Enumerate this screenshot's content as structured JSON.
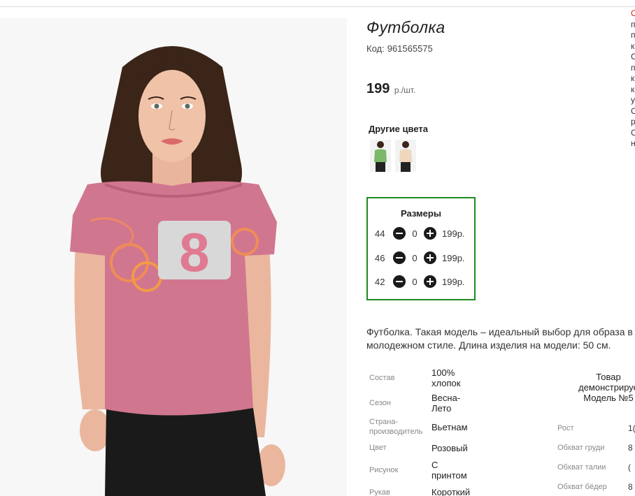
{
  "product": {
    "title": "Футболка",
    "code_label": "Код:",
    "code": "961565575",
    "price": "199",
    "price_unit": "р./шт.",
    "other_colors_label": "Другие цвета",
    "thumbnails": [
      {
        "color": "green"
      },
      {
        "color": "beige"
      }
    ]
  },
  "sizes": {
    "title": "Размеры",
    "rows": [
      {
        "size": "44",
        "qty": "0",
        "price": "199р."
      },
      {
        "size": "46",
        "qty": "0",
        "price": "199р."
      },
      {
        "size": "42",
        "qty": "0",
        "price": "199р."
      }
    ]
  },
  "description": {
    "line1": "Футболка. Такая модель – идеальный выбор для образа в",
    "line2": "молодежном стиле. Длина изделия на модели: 50 см."
  },
  "specs": [
    {
      "label": "Состав",
      "value": "100% хлопок"
    },
    {
      "label": "Сезон",
      "value": "Весна-Лето"
    },
    {
      "label": "Страна-производитель",
      "value": "Вьетнам"
    },
    {
      "label": "Цвет",
      "value": "Розовый"
    },
    {
      "label": "Рисунок",
      "value": "С принтом"
    },
    {
      "label": "Рукав",
      "value": "Короткий"
    }
  ],
  "model": {
    "note_line1": "Товар",
    "note_line2": "демонстрируе",
    "note_line3": "Модель №5",
    "measurements": [
      {
        "label": "Рост",
        "value": "1("
      },
      {
        "label": "Обхват груди",
        "value": "8"
      },
      {
        "label": "Обхват талии",
        "value": "("
      },
      {
        "label": "Обхват бёдер",
        "value": "8"
      }
    ]
  },
  "side_fragment": [
    "С",
    "п",
    "п",
    "к",
    "С",
    "п",
    "к",
    "к",
    "у",
    "С",
    "р",
    "С",
    "н"
  ],
  "colors": {
    "accent_green": "#1f8a1f",
    "shirt_pink": "#d1768f",
    "side_red": "#cc2222"
  }
}
